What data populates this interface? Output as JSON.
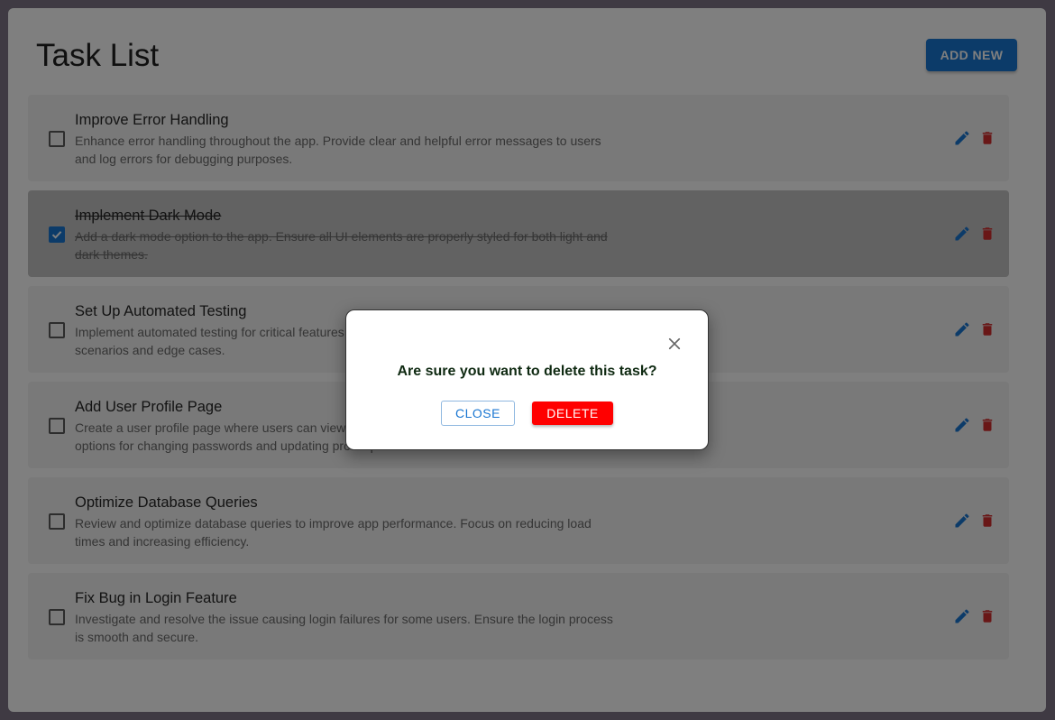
{
  "header": {
    "title": "Task List",
    "add_label": "ADD NEW"
  },
  "tasks": [
    {
      "title": "Improve Error Handling",
      "description": "Enhance error handling throughout the app. Provide clear and helpful error messages to users and log errors for debugging purposes.",
      "completed": false
    },
    {
      "title": "Implement Dark Mode",
      "description": "Add a dark mode option to the app. Ensure all UI elements are properly styled for both light and dark themes.",
      "completed": true
    },
    {
      "title": "Set Up Automated Testing",
      "description": "Implement automated testing for critical features. Write unit and integration tests to cover key scenarios and edge cases.",
      "completed": false
    },
    {
      "title": "Add User Profile Page",
      "description": "Create a user profile page where users can view and edit their personal information. Include options for changing passwords and updating profile pictures.",
      "completed": false
    },
    {
      "title": "Optimize Database Queries",
      "description": "Review and optimize database queries to improve app performance. Focus on reducing load times and increasing efficiency.",
      "completed": false
    },
    {
      "title": "Fix Bug in Login Feature",
      "description": "Investigate and resolve the issue causing login failures for some users. Ensure the login process is smooth and secure.",
      "completed": false
    }
  ],
  "dialog": {
    "message": "Are sure you want to delete this task?",
    "close_label": "CLOSE",
    "delete_label": "DELETE"
  },
  "colors": {
    "primary": "#1976d2",
    "danger": "#ff0000",
    "delete_icon": "#d32f2f",
    "overlay": "#7f7487"
  },
  "icons": {
    "edit": "pencil-icon",
    "delete": "trash-icon",
    "close": "close-icon",
    "check": "check-icon"
  }
}
